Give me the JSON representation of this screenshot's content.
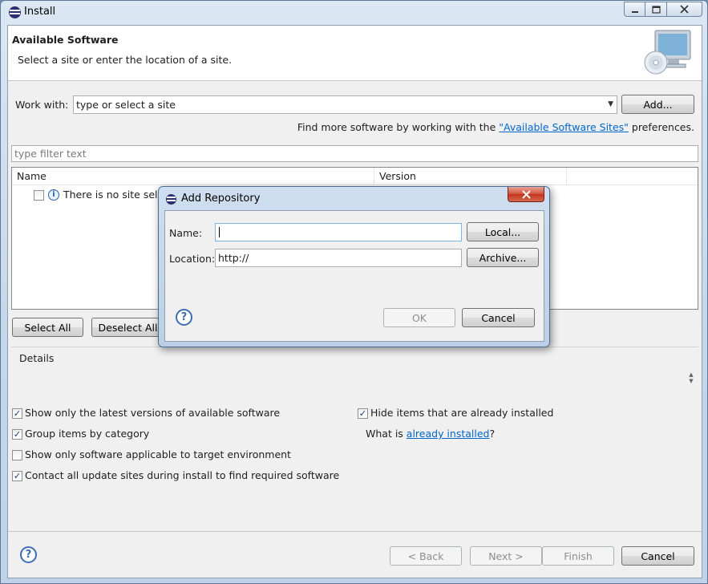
{
  "window": {
    "title": "Install"
  },
  "header": {
    "title": "Available Software",
    "subtitle": "Select a site or enter the location of a site."
  },
  "work_with": {
    "label": "Work with:",
    "value": "type or select a site",
    "add_button": "Add...",
    "hint_prefix": "Find more software by working with the ",
    "hint_link": "\"Available Software Sites\"",
    "hint_suffix": " preferences."
  },
  "filter": {
    "placeholder": "type filter text"
  },
  "table": {
    "columns": [
      "Name",
      "Version"
    ],
    "message": "There is no site selected."
  },
  "selection_buttons": {
    "select_all": "Select All",
    "deselect_all": "Deselect All"
  },
  "details": {
    "label": "Details"
  },
  "options": {
    "latest_versions": {
      "label": "Show only the latest versions of available software",
      "checked": true
    },
    "group_by_category": {
      "label": "Group items by category",
      "checked": true
    },
    "target_env": {
      "label": "Show only software applicable to target environment",
      "checked": false
    },
    "contact_sites": {
      "label": "Contact all update sites during install to find required software",
      "checked": true
    },
    "hide_installed": {
      "label": "Hide items that are already installed",
      "checked": true
    },
    "what_is_prefix": "What is ",
    "what_is_link": "already installed",
    "what_is_suffix": "?"
  },
  "footer": {
    "back": "< Back",
    "next": "Next >",
    "finish": "Finish",
    "cancel": "Cancel"
  },
  "dialog": {
    "title": "Add Repository",
    "name_label": "Name:",
    "name_value": "",
    "location_label": "Location:",
    "location_value": "http://",
    "local_button": "Local...",
    "archive_button": "Archive...",
    "ok_button": "OK",
    "cancel_button": "Cancel"
  },
  "icons": {
    "app": "eclipse-icon",
    "header_art": "monitor-cd-icon",
    "info": "info-icon",
    "help": "help-icon",
    "close": "close-icon"
  }
}
